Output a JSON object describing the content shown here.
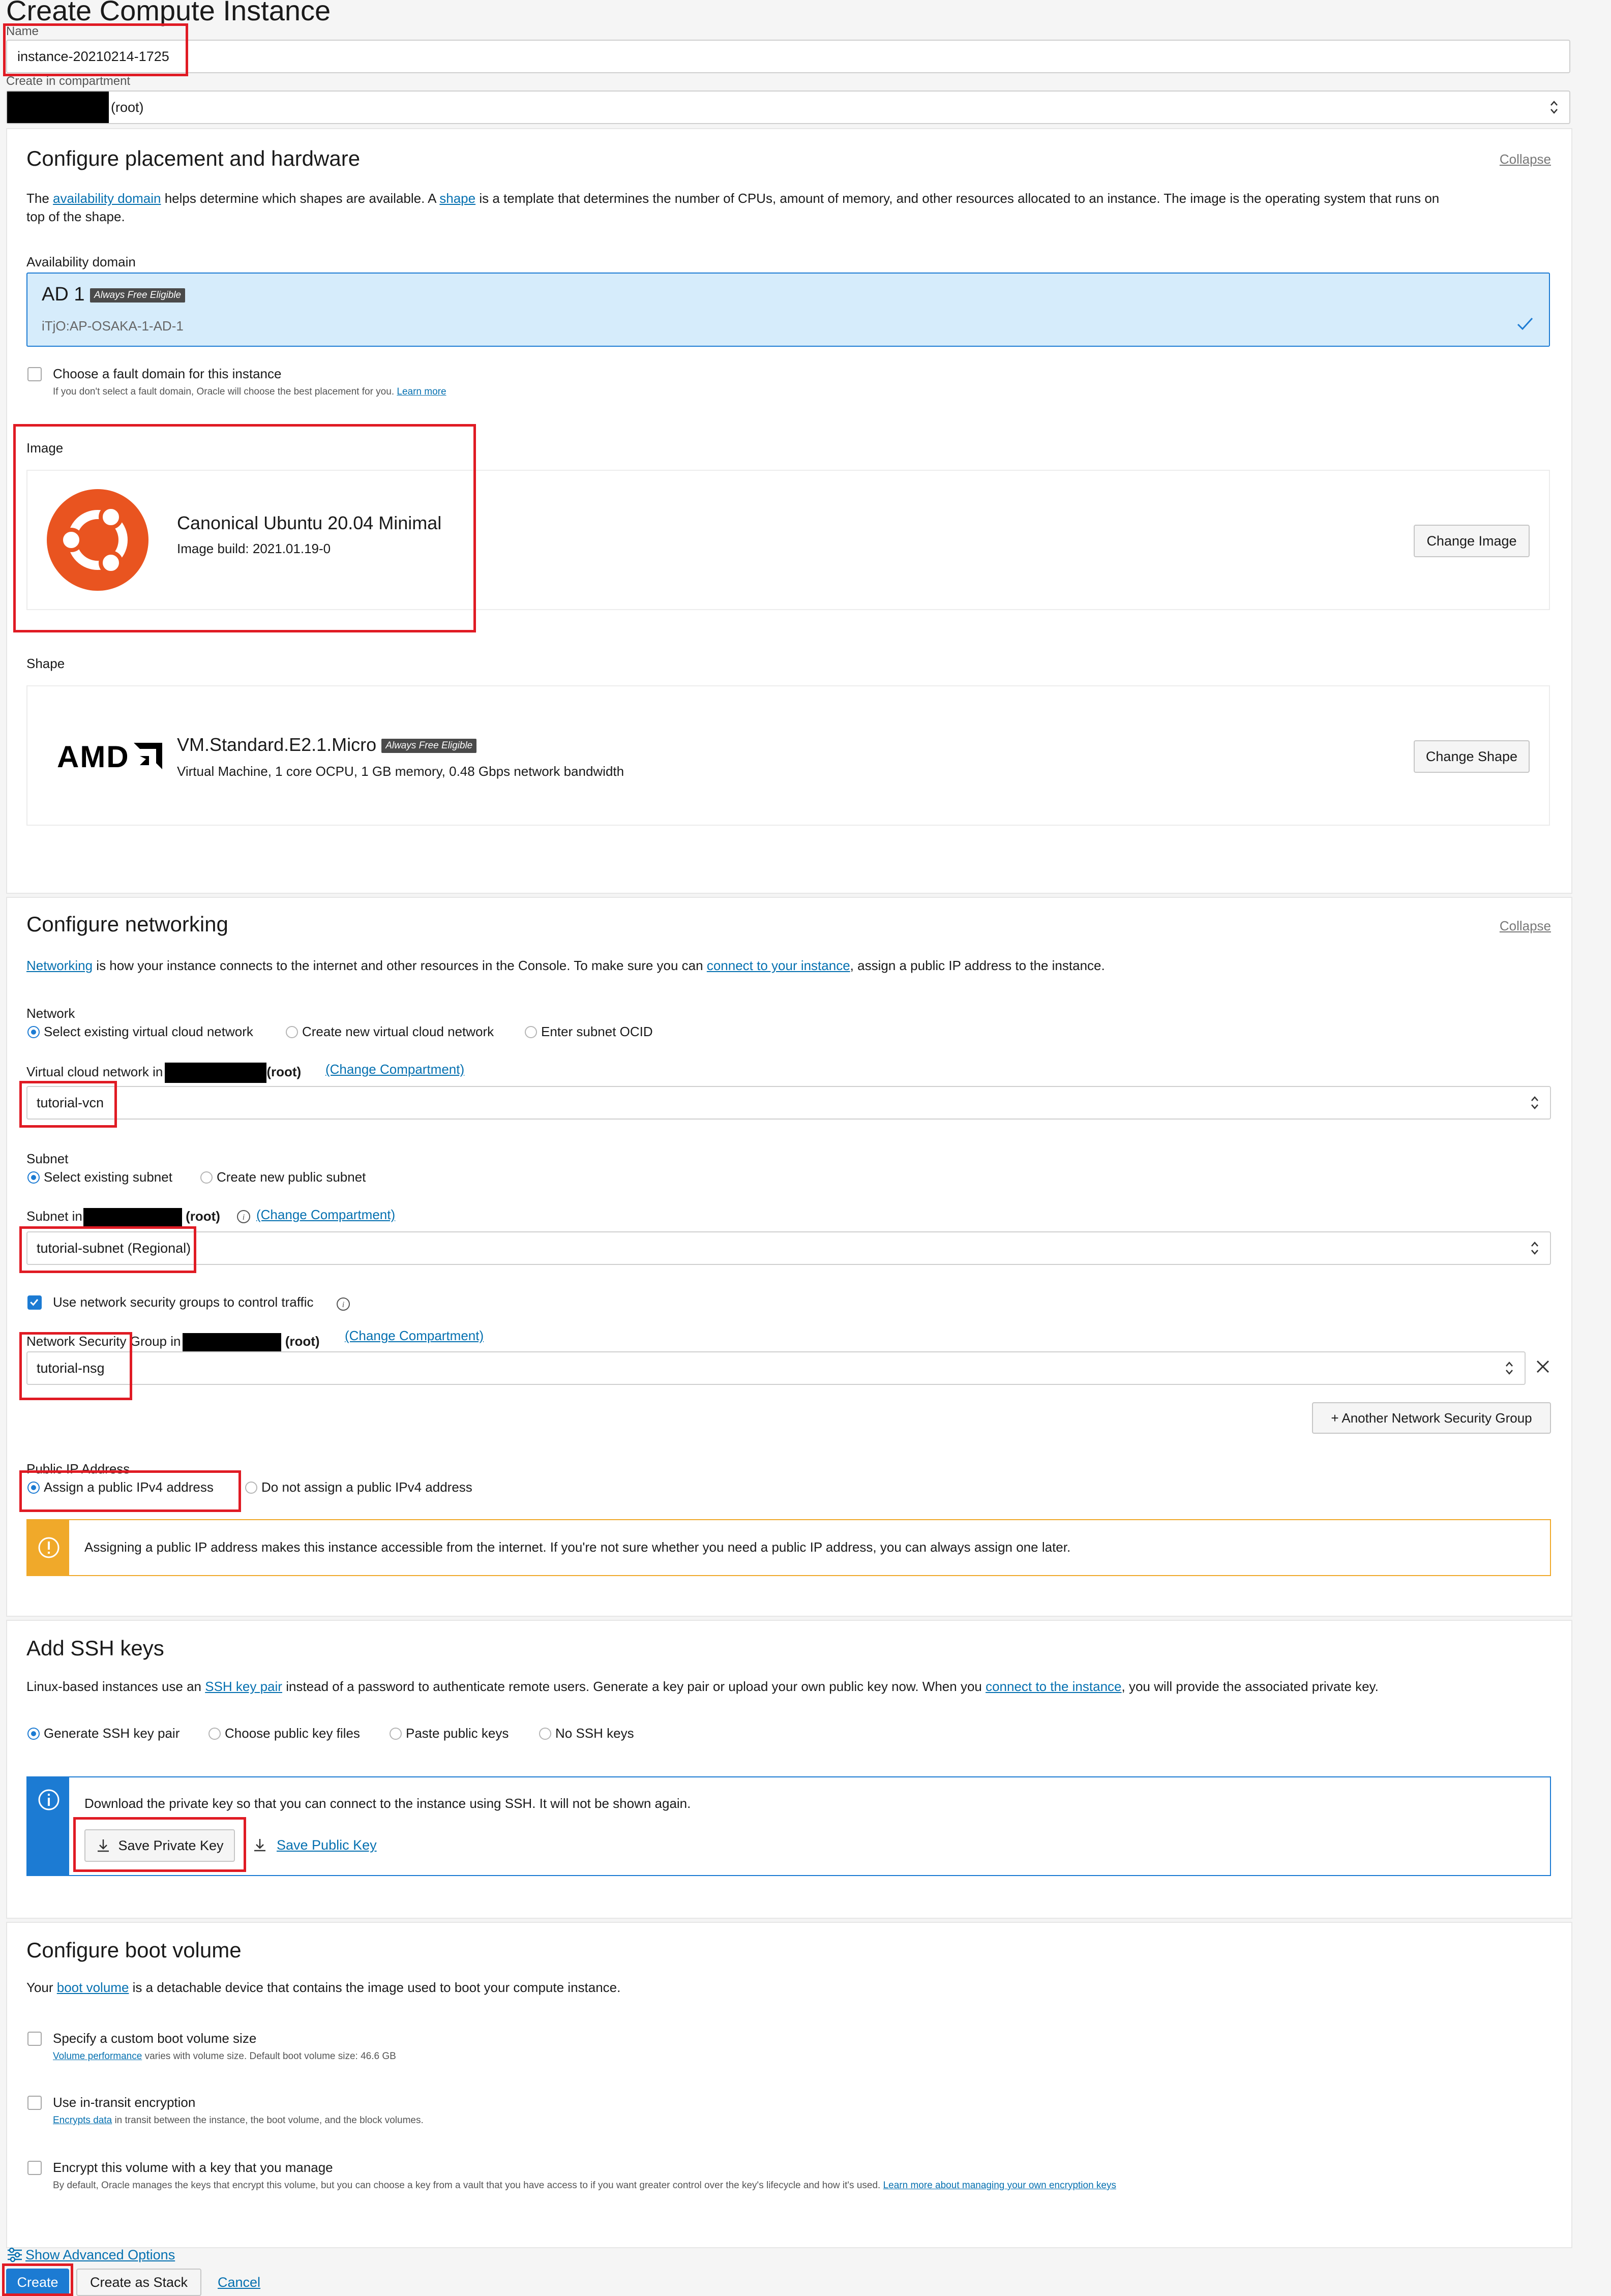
{
  "page_title": "Create Compute Instance",
  "name_field": {
    "label": "Name",
    "value": "instance-20210214-1725"
  },
  "compartment": {
    "label": "Create in compartment",
    "value": "(root)"
  },
  "placement": {
    "title": "Configure placement and hardware",
    "collapse": "Collapse",
    "desc_1": "The ",
    "desc_link_1": "availability domain",
    "desc_2": " helps determine which shapes are available. A ",
    "desc_link_2": "shape",
    "desc_3": " is a template that determines the number of CPUs, amount of memory, and other resources allocated to an instance. The image is the operating system that runs on",
    "desc_4": "top of the shape.",
    "ad_label": "Availability domain",
    "ad_name": "AD 1",
    "ad_badge": "Always Free Eligible",
    "ad_sub": "iTjO:AP-OSAKA-1-AD-1",
    "fault_label": "Choose a fault domain for this instance",
    "fault_help": "If you don't select a fault domain, Oracle will choose the best placement for you.",
    "fault_learn": "Learn more",
    "image_label": "Image",
    "image_name": "Canonical Ubuntu 20.04 Minimal",
    "image_build": "Image build: 2021.01.19-0",
    "change_image": "Change Image",
    "shape_label": "Shape",
    "shape_logo": "AMD",
    "shape_name": "VM.Standard.E2.1.Micro",
    "shape_badge": "Always Free Eligible",
    "shape_desc": "Virtual Machine, 1 core OCPU, 1 GB memory, 0.48 Gbps network bandwidth",
    "change_shape": "Change Shape"
  },
  "networking": {
    "title": "Configure networking",
    "collapse": "Collapse",
    "desc_link_1": "Networking",
    "desc_2": " is how your instance connects to the internet and other resources in the Console. To make sure you can ",
    "desc_link_2": "connect to your instance",
    "desc_3": ", assign a public IP address to the instance.",
    "network_label": "Network",
    "network_options": [
      "Select existing virtual cloud network",
      "Create new virtual cloud network",
      "Enter subnet OCID"
    ],
    "vcn_label": "Virtual cloud network in",
    "root": "(root)",
    "change_compartment": "(Change Compartment)",
    "vcn_value": "tutorial-vcn",
    "subnet_label": "Subnet",
    "subnet_options": [
      "Select existing subnet",
      "Create new public subnet"
    ],
    "subnet_in_label": "Subnet in",
    "subnet_value": "tutorial-subnet (Regional)",
    "nsg_check_label": "Use network security groups to control traffic",
    "nsg_label": "Network Security Group in",
    "nsg_value": "tutorial-nsg",
    "another_nsg": "+ Another Network Security Group",
    "public_ip_label": "Public IP Address",
    "public_ip_options": [
      "Assign a public IPv4 address",
      "Do not assign a public IPv4 address"
    ],
    "warning": "Assigning a public IP address makes this instance accessible from the internet. If you're not sure whether you need a public IP address, you can always assign one later."
  },
  "ssh": {
    "title": "Add SSH keys",
    "desc_1": "Linux-based instances use an ",
    "desc_link_1": "SSH key pair",
    "desc_2": " instead of a password to authenticate remote users. Generate a key pair or upload your own public key now. When you ",
    "desc_link_2": "connect to the instance",
    "desc_3": ", you will provide the associated private key.",
    "options": [
      "Generate SSH key pair",
      "Choose public key files",
      "Paste public keys",
      "No SSH keys"
    ],
    "info": "Download the private key so that you can connect to the instance using SSH. It will not be shown again.",
    "save_private": "Save Private Key",
    "save_public": "Save Public Key"
  },
  "boot": {
    "title": "Configure boot volume",
    "desc_1": "Your ",
    "desc_link": "boot volume",
    "desc_2": " is a detachable device that contains the image used to boot your compute instance.",
    "opt1_label": "Specify a custom boot volume size",
    "opt1_link": "Volume performance",
    "opt1_help": " varies with volume size. Default boot volume size: 46.6 GB",
    "opt2_label": "Use in-transit encryption",
    "opt2_link": "Encrypts data",
    "opt2_help": " in transit between the instance, the boot volume, and the block volumes.",
    "opt3_label": "Encrypt this volume with a key that you manage",
    "opt3_help": "By default, Oracle manages the keys that encrypt this volume, but you can choose a key from a vault that you have access to if you want greater control over the key's lifecycle and how it's used. ",
    "opt3_link": "Learn more about managing your own encryption keys"
  },
  "footer": {
    "advanced": "Show Advanced Options",
    "create": "Create",
    "create_stack": "Create as Stack",
    "cancel": "Cancel"
  },
  "colors": {
    "accent": "#1c7bd3",
    "highlight_box": "#e01b24",
    "ad_selected_bg": "#d6ecfb",
    "warning": "#f0a92a",
    "ubuntu": "#e95420"
  }
}
